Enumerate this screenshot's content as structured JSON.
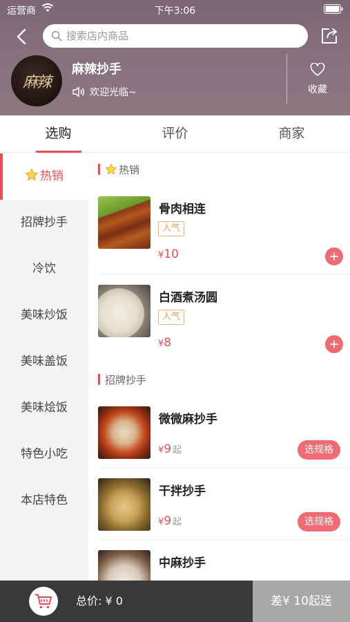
{
  "status_bar": {
    "carrier": "运营商",
    "time": "下午3:06"
  },
  "search": {
    "placeholder": "搜索店内商品"
  },
  "shop": {
    "name": "麻辣抄手",
    "notice": "欢迎光临~",
    "favorite_label": "收藏",
    "logo_text": "麻辣"
  },
  "tabs": [
    {
      "label": "选购",
      "active": true
    },
    {
      "label": "评价",
      "active": false
    },
    {
      "label": "商家",
      "active": false
    }
  ],
  "categories": [
    {
      "label": "热销",
      "active": true,
      "icon": "star-icon"
    },
    {
      "label": "招牌抄手"
    },
    {
      "label": "冷饮"
    },
    {
      "label": "美味炒饭"
    },
    {
      "label": "美味盖饭"
    },
    {
      "label": "美味烩饭"
    },
    {
      "label": "特色小吃"
    },
    {
      "label": "本店特色"
    }
  ],
  "sections": [
    {
      "title": "热销",
      "icon": "star-icon",
      "items": [
        {
          "name": "骨肉相连",
          "tag": "人气",
          "currency": "¥",
          "price": "10",
          "action": "add"
        },
        {
          "name": "白酒煮汤圆",
          "tag": "人气",
          "currency": "¥",
          "price": "8",
          "action": "add"
        }
      ]
    },
    {
      "title": "招牌抄手",
      "items": [
        {
          "name": "微微麻抄手",
          "currency": "¥",
          "price": "9",
          "suffix": "起",
          "action": "选规格"
        },
        {
          "name": "干拌抄手",
          "currency": "¥",
          "price": "9",
          "suffix": "起",
          "action": "选规格"
        },
        {
          "name": "中麻抄手"
        }
      ]
    }
  ],
  "cart": {
    "total_label": "总价: ¥ 0",
    "min_order_label": "差¥ 10起送"
  },
  "colors": {
    "accent": "#e94e57",
    "cart_bar": "#37393b",
    "min_order_bg": "#a7a7a7"
  }
}
